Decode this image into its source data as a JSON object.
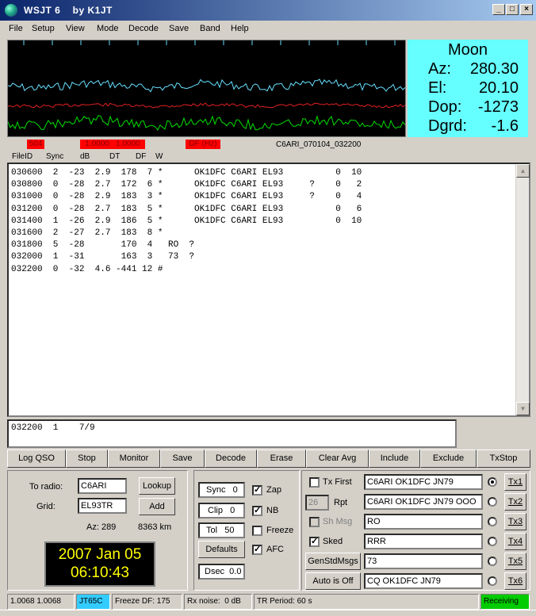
{
  "window": {
    "title": "WSJT 6    by K1JT"
  },
  "menu": [
    "File",
    "Setup",
    "View",
    "Mode",
    "Decode",
    "Save",
    "Band",
    "Help"
  ],
  "moon": {
    "title": "Moon",
    "rows": [
      {
        "label": "Az:",
        "value": "280.30"
      },
      {
        "label": "El:",
        "value": "20.10"
      },
      {
        "label": "Dop:",
        "value": "-1273"
      },
      {
        "label": "Dgrd:",
        "value": "-1.6"
      }
    ]
  },
  "spectrum_status": {
    "box1": "504",
    "box2": "1.0000   1.0000",
    "box3": "DF (Hz)",
    "filename": "C6ARI_070104_032200"
  },
  "columns": [
    "FileID",
    "Sync",
    "dB",
    "DT",
    "DF",
    "W"
  ],
  "decodes": [
    "030600  2  -23  2.9  178  7 *      OK1DFC C6ARI EL93          0  10",
    "030800  0  -28  2.7  172  6 *      OK1DFC C6ARI EL93     ?    0   2",
    "031000  0  -28  2.9  183  3 *      OK1DFC C6ARI EL93     ?    0   4",
    "031200  0  -28  2.7  183  5 *      OK1DFC C6ARI EL93          0   6",
    "031400  1  -26  2.9  186  5 *      OK1DFC C6ARI EL93          0  10",
    "031600  2  -27  2.7  183  8 *",
    "031800  5  -28       170  4   RO  ?",
    "032000  1  -31       163  3   73  ?",
    "032200  0  -32  4.6 -441 12 #"
  ],
  "average": "032200  1    7/9",
  "buttons": [
    "Log QSO",
    "Stop",
    "Monitor",
    "Save",
    "Decode",
    "Erase",
    "Clear Avg",
    "Include",
    "Exclude",
    "TxStop"
  ],
  "station": {
    "to_radio_label": "To radio:",
    "to_radio_value": "C6ARI",
    "grid_label": "Grid:",
    "grid_value": "EL93TR",
    "lookup_label": "Lookup",
    "add_label": "Add",
    "az": "Az: 289",
    "dist": "8363 km",
    "date": "2007 Jan 05",
    "time": "06:10:43"
  },
  "decode_params": {
    "sync": "Sync   0",
    "clip": "Clip   0",
    "tol": "Tol   50",
    "defaults": "Defaults",
    "dsec": "Dsec  0.0",
    "zap_label": "Zap",
    "nb_label": "NB",
    "freeze_label": "Freeze",
    "afc_label": "AFC",
    "zap": true,
    "nb": true,
    "freeze": false,
    "afc": true
  },
  "tx": {
    "tx_first_label": "Tx First",
    "tx_first": false,
    "rpt_value": "26",
    "rpt_label": "Rpt",
    "sh_msg_label": "Sh Msg",
    "sh_msg": false,
    "sked_label": "Sked",
    "sked": true,
    "gen_label": "GenStdMsgs",
    "auto_label": "Auto is Off",
    "messages": [
      "C6ARI OK1DFC JN79",
      "C6ARI OK1DFC JN79 OOO",
      "RO",
      "RRR",
      "73",
      "CQ OK1DFC JN79"
    ],
    "tx_buttons": [
      "Tx1",
      "Tx2",
      "Tx3",
      "Tx4",
      "Tx5",
      "Tx6"
    ],
    "selected": 0
  },
  "status": {
    "ratio": "1.0068 1.0068",
    "mode": "JT65C",
    "freeze_df": "Freeze DF: 175",
    "rx_noise": "Rx noise:  0 dB",
    "tr_period": "TR Period: 60 s",
    "receiving": "Receiving"
  },
  "colors": {
    "moon_bg": "#66ffff",
    "mode_bg": "#33ccff",
    "receiving_bg": "#00cc00",
    "trace_cyan": "#66e0ff",
    "trace_red": "#e02020",
    "trace_green": "#00e000"
  }
}
